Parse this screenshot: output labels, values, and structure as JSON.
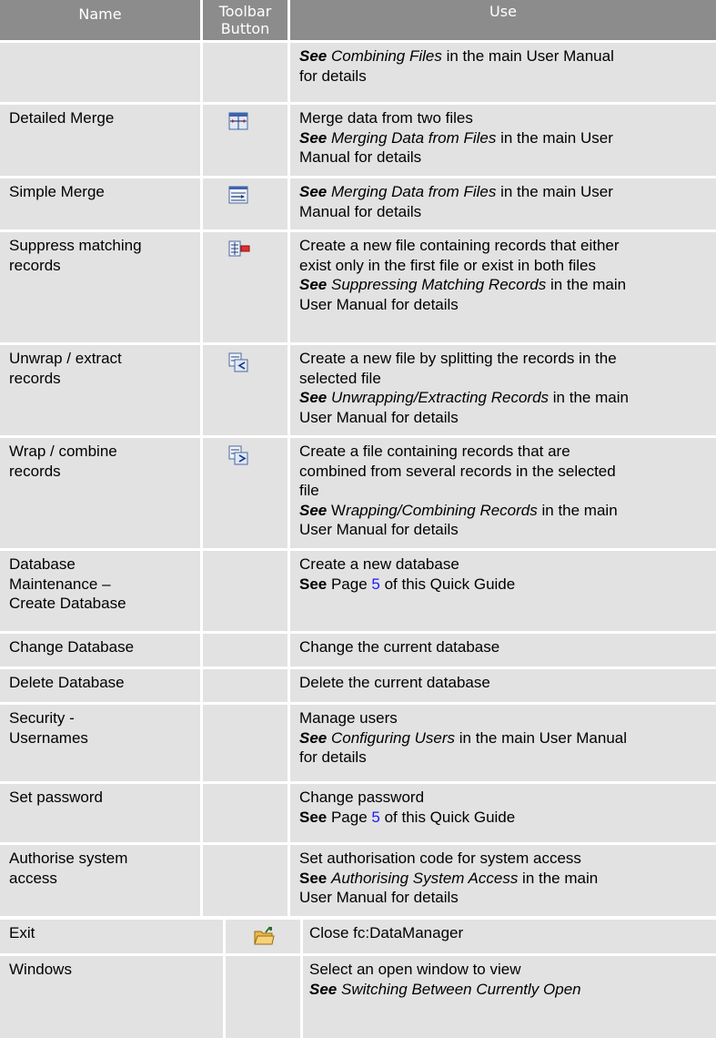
{
  "header": {
    "name": "Name",
    "toolbar_button_1": "Toolbar",
    "toolbar_button_2": "Button",
    "use": "Use"
  },
  "rows": [
    {
      "name": "",
      "icon": "",
      "use": {
        "see": "See",
        "ref": "Combining Files",
        "tail": " in the main User Manual\nfor details"
      }
    },
    {
      "name": "Detailed Merge",
      "icon": "detailed-merge-icon",
      "use": {
        "lead": "Merge data from two files\n",
        "see": "See",
        "ref": "Merging Data from Files",
        "tail": " in the main User\nManual for details"
      }
    },
    {
      "name": "Simple Merge",
      "icon": "simple-merge-icon",
      "use": {
        "see": "See",
        "ref": "Merging Data from Files",
        "tail": " in the main User\nManual for details"
      }
    },
    {
      "name": "Suppress matching\nrecords",
      "icon": "suppress-matching-icon",
      "use": {
        "lead": "Create a new file containing records that either\nexist only in the first file or exist in both files\n",
        "see": "See",
        "ref": "Suppressing Matching Records",
        "tail": " in the main\nUser Manual for details"
      }
    },
    {
      "name": "Unwrap / extract\nrecords",
      "icon": "unwrap-records-icon",
      "use": {
        "lead": "Create a new file by splitting the records in the\nselected file\n",
        "see": "See",
        "ref": "Unwrapping/Extracting Records",
        "tail": " in the main\nUser Manual for details"
      }
    },
    {
      "name": "Wrap / combine\nrecords",
      "icon": "wrap-records-icon",
      "use": {
        "lead": "Create a file containing records that are\ncombined from several records in the selected\nfile\n",
        "see": "See",
        "see_extra": " W",
        "ref": "rapping/Combining Records",
        "tail": " in the main\nUser Manual for details"
      }
    },
    {
      "name": "Database\nMaintenance –\n Create Database",
      "icon": "",
      "use": {
        "lead": "Create a new database\n",
        "see_plain": "See",
        "mid": " Page ",
        "link": "5",
        "tail": " of this Quick Guide"
      }
    },
    {
      "name": " Change Database",
      "icon": "",
      "use": {
        "lead": "Change the current database"
      }
    },
    {
      "name": " Delete Database",
      "icon": "",
      "use": {
        "lead": "Delete the current database"
      }
    },
    {
      "name": "Security -\n Usernames",
      "icon": "",
      "use": {
        "lead": "Manage users\n",
        "see": "See",
        "ref": "Configuring Users",
        "tail": " in the main User Manual\nfor details"
      }
    },
    {
      "name": " Set password",
      "icon": "",
      "use": {
        "lead": "Change password\n",
        "see_plain": "See",
        "mid": " Page ",
        "link": "5",
        "tail": " of this Quick Guide"
      }
    },
    {
      "name": "Authorise system\naccess",
      "icon": "",
      "use": {
        "lead": "Set authorisation code for system access\n",
        "see_plain": "See",
        "ref_space": " ",
        "ref": "Authorising System Access",
        "tail": " in the main\nUser Manual for details"
      }
    },
    {
      "name": "Exit",
      "icon": "exit-folder-icon",
      "use": {
        "lead": "Close fc:DataManager"
      }
    },
    {
      "name": "Windows",
      "icon": "",
      "use": {
        "lead": "Select an open window to view\n",
        "see": "See",
        "ref": "Switching Between Currently Open",
        "tail": ""
      }
    }
  ],
  "colors": {
    "header_bg": "#8c8c8c",
    "cell_bg": "#e2e2e2",
    "link": "#1a1af5"
  }
}
